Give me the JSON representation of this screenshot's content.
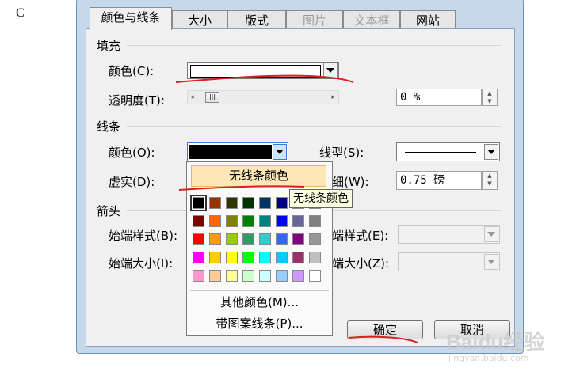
{
  "doc_char": "C",
  "tabs": [
    {
      "label": "颜色与线条",
      "state": "active"
    },
    {
      "label": "大小",
      "state": "normal"
    },
    {
      "label": "版式",
      "state": "normal"
    },
    {
      "label": "图片",
      "state": "disabled"
    },
    {
      "label": "文本框",
      "state": "disabled"
    },
    {
      "label": "网站",
      "state": "normal"
    }
  ],
  "fill": {
    "section": "填充",
    "color_label": "颜色(C):",
    "transparency_label": "透明度(T):",
    "transparency_value": "0 %",
    "color_value": "#ffffff"
  },
  "line": {
    "section": "线条",
    "color_label": "颜色(O):",
    "color_value": "#000000",
    "dash_label": "虚实(D):",
    "style_label": "线型(S):",
    "weight_label": "细(W):",
    "weight_value": "0.75 磅"
  },
  "arrows": {
    "section": "箭头",
    "begin_style": "始端样式(B):",
    "begin_size": "始端大小(I):",
    "end_style": "端样式(E):",
    "end_size": "端大小(Z):"
  },
  "palette": {
    "no_line": "无线条颜色",
    "tooltip": "无线条颜色",
    "more_colors": "其他颜色(M)...",
    "patterned": "带图案线条(P)...",
    "colors": [
      [
        "#000000",
        "#993300",
        "#333300",
        "#003300",
        "#003366",
        "#000080",
        "#333399",
        "#333333"
      ],
      [
        "#800000",
        "#FF6600",
        "#808000",
        "#008000",
        "#008080",
        "#0000FF",
        "#666699",
        "#808080"
      ],
      [
        "#FF0000",
        "#FF9900",
        "#99CC00",
        "#339966",
        "#33CCCC",
        "#3366FF",
        "#800080",
        "#969696"
      ],
      [
        "#FF00FF",
        "#FFCC00",
        "#FFFF00",
        "#00FF00",
        "#00FFFF",
        "#00CCFF",
        "#993366",
        "#C0C0C0"
      ],
      [
        "#FF99CC",
        "#FFCC99",
        "#FFFF99",
        "#CCFFCC",
        "#CCFFFF",
        "#99CCFF",
        "#CC99FF",
        "#FFFFFF"
      ]
    ]
  },
  "buttons": {
    "ok": "确定",
    "cancel": "取消"
  },
  "watermark": {
    "brand": "Baidu",
    "brand_cn": "经验",
    "url": "jingyan.baidu.com"
  },
  "annotation_color": "#d81e1e"
}
